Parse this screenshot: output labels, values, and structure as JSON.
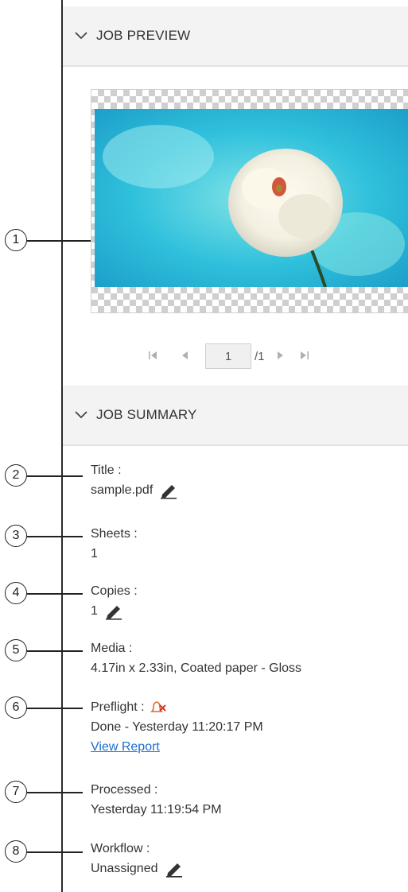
{
  "preview_section": {
    "title": "JOB PREVIEW"
  },
  "pager": {
    "first_icon": "first-page-icon",
    "prev_icon": "previous-page-icon",
    "current_page": "1",
    "total": "/1",
    "next_icon": "next-page-icon",
    "last_icon": "last-page-icon"
  },
  "summary_section": {
    "title": "JOB SUMMARY"
  },
  "fields": {
    "title": {
      "label": "Title :",
      "value": "sample.pdf"
    },
    "sheets": {
      "label": "Sheets :",
      "value": "1"
    },
    "copies": {
      "label": "Copies :",
      "value": "1"
    },
    "media": {
      "label": "Media :",
      "value": "4.17in x 2.33in, Coated paper - Gloss"
    },
    "preflight": {
      "label": "Preflight :",
      "value": "Done - Yesterday 11:20:17 PM",
      "link": "View Report",
      "status_icon": "preflight-error-icon"
    },
    "processed": {
      "label": "Processed :",
      "value": "Yesterday 11:19:54 PM"
    },
    "workflow": {
      "label": "Workflow :",
      "value": "Unassigned"
    }
  },
  "callouts": [
    "1",
    "2",
    "3",
    "4",
    "5",
    "6",
    "7",
    "8"
  ],
  "colors": {
    "link": "#1a6fcf",
    "alert": "#e0662a",
    "header_bg": "#f3f3f3"
  }
}
